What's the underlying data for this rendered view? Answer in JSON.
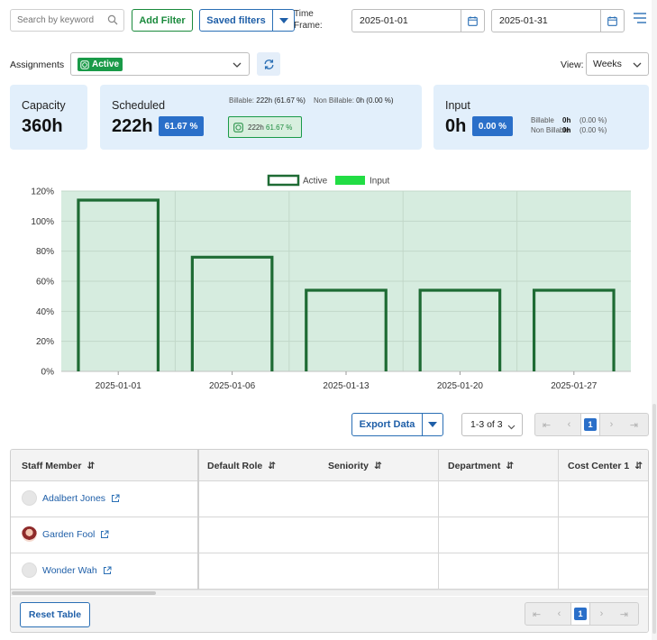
{
  "toolbar": {
    "search_placeholder": "Search by keyword",
    "add_filter": "Add Filter",
    "saved_filters": "Saved filters",
    "time_frame_label": "Time Frame:",
    "date_from": "2025-01-01",
    "date_to": "2025-01-31"
  },
  "assignments": {
    "label": "Assignments",
    "selected": "Active"
  },
  "view": {
    "label": "View:",
    "selected": "Weeks"
  },
  "cards": {
    "capacity": {
      "title": "Capacity",
      "value": "360h"
    },
    "scheduled": {
      "title": "Scheduled",
      "value": "222h",
      "percent": "61.67 %",
      "billable_label": "Billable:",
      "billable_value": "222h (61.67 %)",
      "nonbillable_label": "Non Billable:",
      "nonbillable_value": "0h (0.00 %)",
      "chip_hours": "222h",
      "chip_percent": "61.67 %"
    },
    "input": {
      "title": "Input",
      "value": "0h",
      "percent": "0.00 %",
      "billable_label": "Billable",
      "billable_hours": "0h",
      "billable_pct": "(0.00 %)",
      "nonbillable_label": "Non Billable",
      "nonbillable_hours": "0h",
      "nonbillable_pct": "(0.00 %)"
    }
  },
  "chart_data": {
    "type": "bar",
    "title": "",
    "xlabel": "",
    "ylabel": "",
    "categories": [
      "2025-01-01",
      "2025-01-06",
      "2025-01-13",
      "2025-01-20",
      "2025-01-27"
    ],
    "series": [
      {
        "name": "Active",
        "values": [
          114,
          76,
          54,
          54,
          54
        ]
      },
      {
        "name": "Input",
        "values": [
          0,
          0,
          0,
          0,
          0
        ]
      }
    ],
    "y_ticks": [
      "0%",
      "20%",
      "40%",
      "60%",
      "80%",
      "100%",
      "120%"
    ],
    "ylim": [
      0,
      120
    ],
    "grid": true,
    "legend_position": "top-center",
    "colors": {
      "active": "#1e6b34",
      "input": "#22dd44",
      "plot_bg": "#d6ecdf"
    }
  },
  "export": {
    "label": "Export Data",
    "count": "1-3 of 3"
  },
  "pager": {
    "current": "1"
  },
  "table": {
    "columns": [
      "Staff Member",
      "Default Role",
      "Seniority",
      "Department",
      "Cost Center 1"
    ],
    "rows": [
      {
        "name": "Adalbert Jones"
      },
      {
        "name": "Garden Fool"
      },
      {
        "name": "Wonder Wah"
      }
    ],
    "reset_label": "Reset Table"
  },
  "colors": {
    "accent_blue": "#2a6fc9",
    "accent_green": "#1a9a48",
    "card_bg": "#e2effb"
  }
}
